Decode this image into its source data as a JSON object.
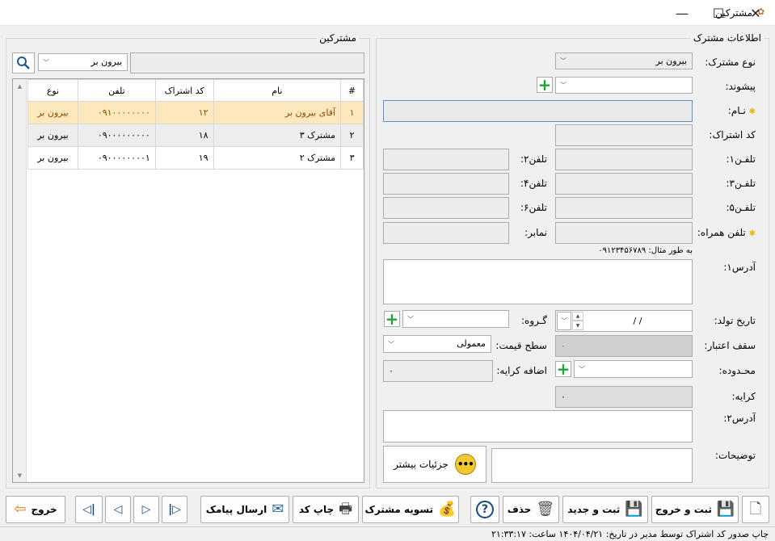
{
  "window": {
    "title": "مشترکین",
    "minimize": "—",
    "maximize": "☐",
    "close": "✕"
  },
  "list_panel": {
    "title": "مشترکین",
    "filter_type_value": "بیرون بر",
    "search_value": "",
    "columns": {
      "num": "#",
      "name": "نام",
      "code": "کد اشتراک",
      "phone": "تلفن",
      "type": "نوع"
    },
    "rows": [
      {
        "num": "۱",
        "name": "آقای بیرون بر",
        "code": "۱۲",
        "phone": "۰۹۱۰۰۰۰۰۰۰۰",
        "type": "بیرون بر"
      },
      {
        "num": "۲",
        "name": "مشترک ۳",
        "code": "۱۸",
        "phone": "۰۹۰۰۰۰۰۰۰۰۰",
        "type": "بیرون بر"
      },
      {
        "num": "۳",
        "name": "مشترک ۲",
        "code": "۱۹",
        "phone": "۰۹۰۰۰۰۰۰۰۰۱",
        "type": "بیرون بر"
      }
    ]
  },
  "info_panel": {
    "title": "اطلاعات مشترک",
    "customer_type": {
      "label": "نوع مشترک:",
      "value": "بیرون بر"
    },
    "prefix": {
      "label": "پیشوند:",
      "value": ""
    },
    "name": {
      "label": "نـام:",
      "value": ""
    },
    "code": {
      "label": "کد اشتراک:",
      "value": ""
    },
    "phone1": {
      "label": "تلفـن۱:",
      "value": ""
    },
    "phone2": {
      "label": "تلفن۲:",
      "value": ""
    },
    "phone3": {
      "label": "تلفـن۳:",
      "value": ""
    },
    "phone4": {
      "label": "تلفن۴:",
      "value": ""
    },
    "phone5": {
      "label": "تلفـن۵:",
      "value": ""
    },
    "phone6": {
      "label": "تلفن۶:",
      "value": ""
    },
    "mobile": {
      "label": "تلفن همراه:",
      "value": ""
    },
    "fax": {
      "label": "نمابر:",
      "value": ""
    },
    "mobile_hint": "به طور مثال: ۰۹۱۲۳۴۵۶۷۸۹",
    "address1": {
      "label": "آدرس۱:",
      "value": ""
    },
    "birthdate": {
      "label": "تاریخ تولد:",
      "value": "/     /"
    },
    "group": {
      "label": "گـروه:",
      "value": ""
    },
    "credit_limit": {
      "label": "سقف اعتبار:",
      "value": "۰"
    },
    "price_level": {
      "label": "سطح قیمت:",
      "value": "معمولی"
    },
    "zone": {
      "label": "محـدوده:",
      "value": ""
    },
    "fare_add": {
      "label": "اضافه کرایه:",
      "value": "۰"
    },
    "fare": {
      "label": "کرایه:",
      "value": "۰"
    },
    "address2": {
      "label": "آدرس۲:",
      "value": ""
    },
    "notes": {
      "label": "توضیحات:",
      "value": ""
    },
    "more_details": "جزئیات بیشتر",
    "more_icon": "•••"
  },
  "toolbar": {
    "save_exit": "ثبت و خروج",
    "save_new": "ثبت و جدید",
    "delete": "حذف",
    "help_icon": "?",
    "settle": "تسویه مشترک",
    "print_code": "چاپ کد",
    "send_sms": "ارسال پیامک",
    "exit": "خروج"
  },
  "status": {
    "text": "چاپ صدور کد اشتراک توسط مدیر در تاریخ: ۱۴۰۴/۰۴/۲۱ ساعت: ۲۱:۳۳:۱۷"
  }
}
